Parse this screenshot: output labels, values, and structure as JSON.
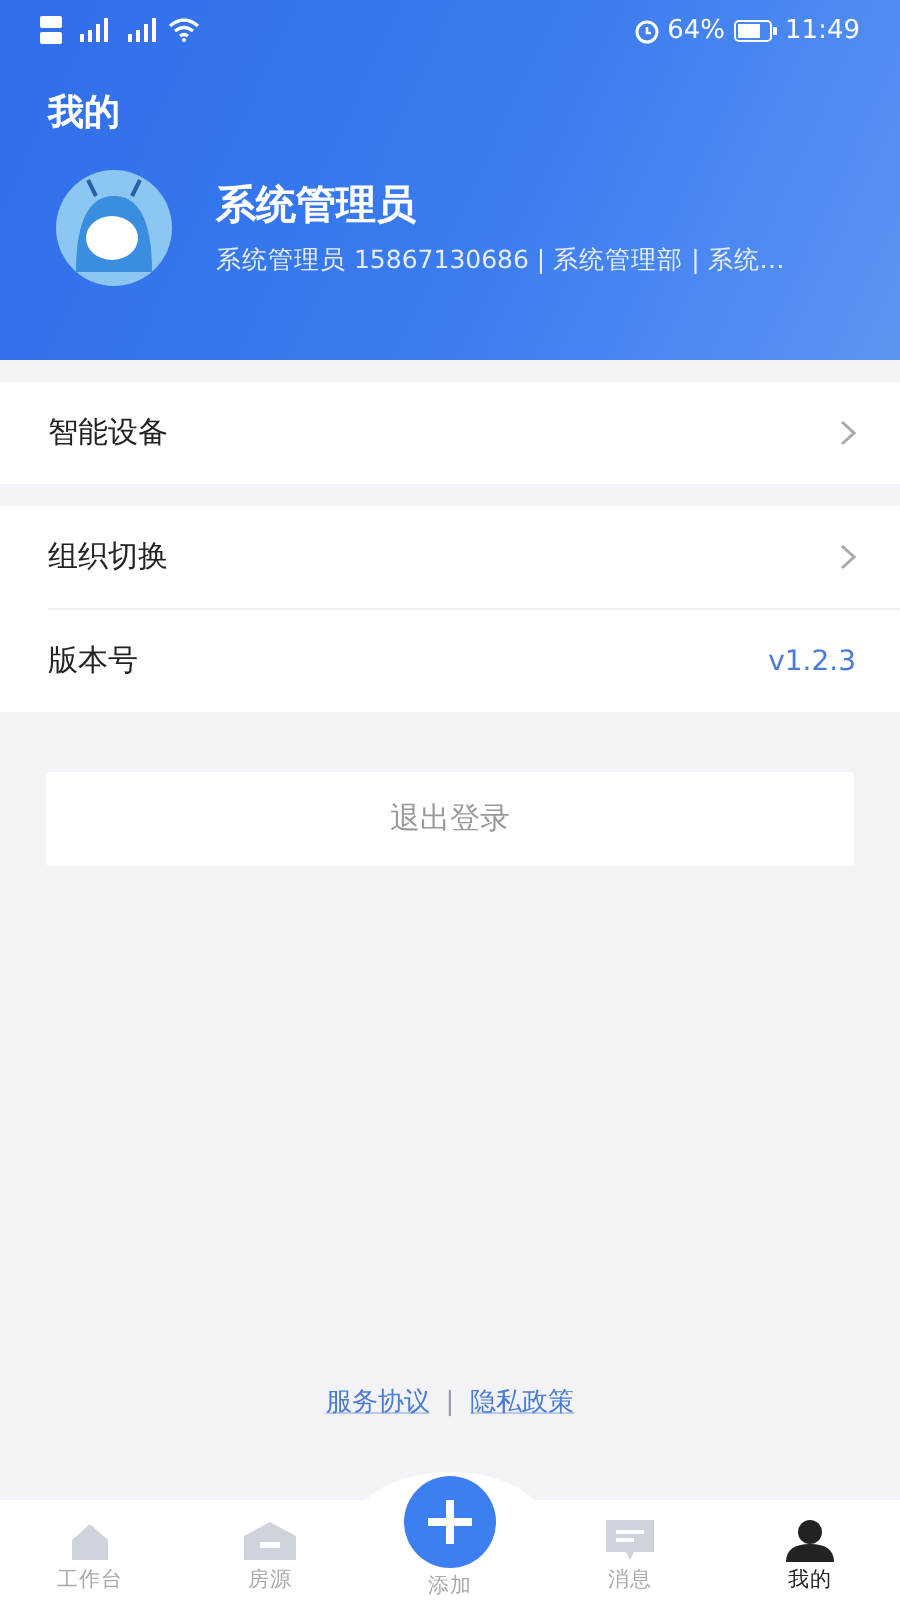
{
  "status_bar": {
    "battery": "64%",
    "time": "11:49"
  },
  "header": {
    "title": "我的",
    "name": "系统管理员",
    "details": "系统管理员 15867130686 | 系统管理部 | 系统…"
  },
  "menu_groups": [
    {
      "items": [
        {
          "label": "智能设备",
          "kind": "link"
        }
      ]
    },
    {
      "items": [
        {
          "label": "组织切换",
          "kind": "link"
        },
        {
          "label": "版本号",
          "kind": "value",
          "value": "v1.2.3"
        }
      ]
    }
  ],
  "logout_button": "退出登录",
  "footer_links": [
    {
      "label": "服务协议"
    },
    {
      "label": "隐私政策"
    }
  ],
  "footer_separator": "|",
  "tab_bar": [
    {
      "label": "工作台",
      "kind": "home",
      "selected": false
    },
    {
      "label": "房源",
      "kind": "house",
      "selected": false
    },
    {
      "label": "添加",
      "kind": "add",
      "selected": false
    },
    {
      "label": "消息",
      "kind": "message",
      "selected": false
    },
    {
      "label": "我的",
      "kind": "person",
      "selected": true
    }
  ]
}
